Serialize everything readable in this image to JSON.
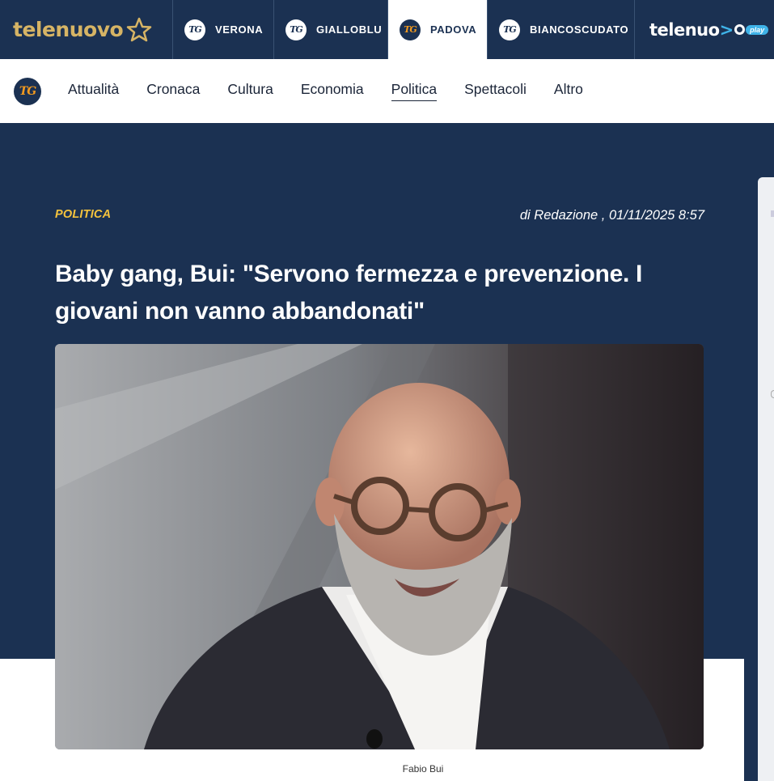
{
  "topbar": {
    "brand": "telenuovo",
    "channels": [
      {
        "label": "VERONA",
        "active": false
      },
      {
        "label": "GIALLOBLU",
        "active": false
      },
      {
        "label": "PADOVA",
        "active": true
      },
      {
        "label": "BIANCOSCUDATO",
        "active": false
      }
    ],
    "play_brand": "telenuo",
    "play_suffix": "play",
    "tg_badge_text": "TG"
  },
  "nav": {
    "logo_text": "TG",
    "items": [
      {
        "label": "Attualità",
        "active": false
      },
      {
        "label": "Cronaca",
        "active": false
      },
      {
        "label": "Cultura",
        "active": false
      },
      {
        "label": "Economia",
        "active": false
      },
      {
        "label": "Politica",
        "active": true
      },
      {
        "label": "Spettacoli",
        "active": false
      },
      {
        "label": "Altro",
        "active": false
      }
    ]
  },
  "article": {
    "category": "POLITICA",
    "byline": "di Redazione , 01/11/2025 8:57",
    "title": "Baby gang, Bui: \"Servono fermezza e prevenzione. I giovani non vanno abbandonati\"",
    "photo_caption": "Fabio Bui"
  },
  "colors": {
    "navy": "#1b3152",
    "gold": "#d6b465",
    "category_yellow": "#f5c33d",
    "tg_orange": "#f39a1e",
    "play_blue": "#3fb3e8"
  }
}
